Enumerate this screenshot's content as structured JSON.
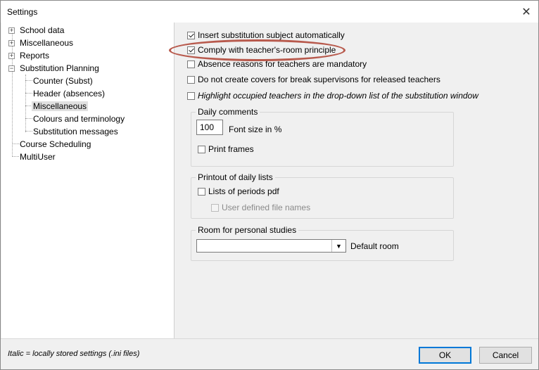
{
  "window": {
    "title": "Settings",
    "close_glyph": "✕"
  },
  "tree": {
    "items": [
      {
        "label": "School data",
        "expander": "+"
      },
      {
        "label": "Miscellaneous",
        "expander": "+"
      },
      {
        "label": "Reports",
        "expander": "+"
      },
      {
        "label": "Substitution Planning",
        "expander": "−"
      },
      {
        "label": "Counter (Subst)"
      },
      {
        "label": "Header (absences)"
      },
      {
        "label": "Miscellaneous",
        "selected": true
      },
      {
        "label": "Colours and terminology"
      },
      {
        "label": "Substitution messages"
      },
      {
        "label": "Course Scheduling"
      },
      {
        "label": "MultiUser"
      }
    ]
  },
  "options": {
    "insert_subject": {
      "label": "Insert substitution subject automatically",
      "checked": true
    },
    "comply_room": {
      "label": "Comply with teacher's-room principle",
      "checked": true
    },
    "absence_reasons": {
      "label": "Absence reasons for teachers are mandatory",
      "checked": false
    },
    "no_covers": {
      "label": "Do not create covers for break supervisons for released teachers",
      "checked": false
    },
    "highlight_occupied": {
      "label": "Highlight occupied teachers in the drop-down list of the substitution window",
      "checked": false
    }
  },
  "daily_comments": {
    "title": "Daily comments",
    "font_size_value": "100",
    "font_size_label": "Font size in %",
    "print_frames_label": "Print frames"
  },
  "printout": {
    "title": "Printout of daily lists",
    "lists_pdf_label": "Lists of periods pdf",
    "user_defined_label": "User defined file names"
  },
  "personal_studies": {
    "title": "Room for personal studies",
    "room_value": "",
    "default_room_label": "Default room"
  },
  "footer": {
    "note": "Italic = locally stored settings (.ini files)",
    "ok_label": "OK",
    "cancel_label": "Cancel"
  }
}
